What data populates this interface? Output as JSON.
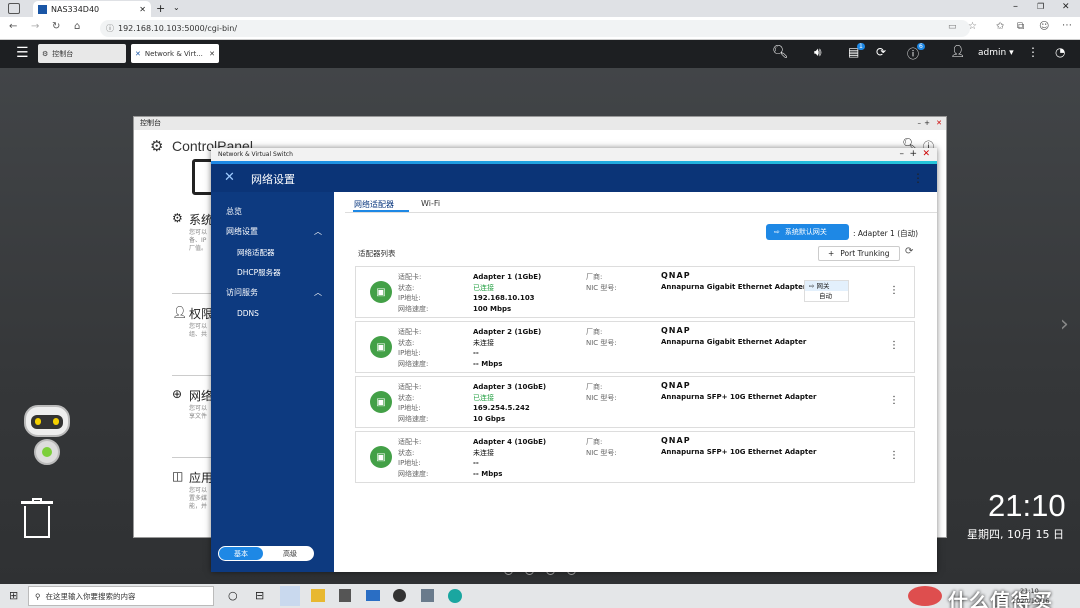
{
  "browser": {
    "tab_title": "NAS334D40",
    "url": "192.168.10.103:5000/cgi-bin/"
  },
  "topbar": {
    "tabs": [
      {
        "label": "控制台"
      },
      {
        "label": "Network & Virt..."
      }
    ],
    "user": "admin",
    "badge_notif": "1",
    "badge_info": "6"
  },
  "controlpanel": {
    "window_title": "控制台",
    "title": "ControlPanel",
    "sections": [
      {
        "label": "系统",
        "desc": "您可以\n备、IP\n厂值。"
      },
      {
        "label": "权限",
        "desc": "您可以\n组、共"
      },
      {
        "label": "网络",
        "desc": "您可以\n享文件"
      },
      {
        "label": "应用",
        "desc": "您可以\n置多媒\n能，并"
      }
    ]
  },
  "nvs": {
    "window_title": "Network & Virtual Switch",
    "header": "网络设置",
    "sidebar": [
      {
        "label": "总览",
        "sub": false
      },
      {
        "label": "网络设置",
        "sub": false,
        "chevron": true
      },
      {
        "label": "网络适配器",
        "sub": true
      },
      {
        "label": "DHCP服务器",
        "sub": true
      },
      {
        "label": "访问服务",
        "sub": false,
        "chevron": true
      },
      {
        "label": "DDNS",
        "sub": true
      }
    ],
    "mode": {
      "basic": "基本",
      "advanced": "高级"
    },
    "tabs": [
      {
        "label": "网络适配器",
        "active": true
      },
      {
        "label": "Wi-Fi",
        "active": false
      }
    ],
    "gateway_button": "系统默认网关",
    "gateway_value": ": Adapter 1 (自动)",
    "port_trunking": "Port Trunking",
    "list_title": "适配器列表",
    "labels": {
      "adapter": "适配卡:",
      "status": "状态:",
      "ip": "IP地址:",
      "speed": "网络速度:",
      "vendor": "厂商:",
      "nic": "NIC 型号:"
    },
    "adapters": [
      {
        "name": "Adapter 1 (1GbE)",
        "status": "已连接",
        "connected": true,
        "ip": "192.168.10.103",
        "speed": "100 Mbps",
        "vendor": "QNAP",
        "nic": "Annapurna Gigabit Ethernet Adapter",
        "gw_tag": "网关",
        "gw_mode": "自动"
      },
      {
        "name": "Adapter 2 (1GbE)",
        "status": "未连接",
        "connected": false,
        "ip": "--",
        "speed": "-- Mbps",
        "vendor": "QNAP",
        "nic": "Annapurna Gigabit Ethernet Adapter"
      },
      {
        "name": "Adapter 3 (10GbE)",
        "status": "已连接",
        "connected": true,
        "ip": "169.254.5.242",
        "speed": "10 Gbps",
        "vendor": "QNAP",
        "nic": "Annapurna SFP+ 10G Ethernet Adapter"
      },
      {
        "name": "Adapter 4 (10GbE)",
        "status": "未连接",
        "connected": false,
        "ip": "--",
        "speed": "-- Mbps",
        "vendor": "QNAP",
        "nic": "Annapurna SFP+ 10G Ethernet Adapter"
      }
    ]
  },
  "clock": {
    "time": "21:10",
    "date": "星期四, 10月 15 日"
  },
  "taskbar": {
    "search_placeholder": "在这里输入你要搜索的内容",
    "time": "21:10",
    "date": "2020/10/16",
    "watermark": "什么值得买"
  }
}
